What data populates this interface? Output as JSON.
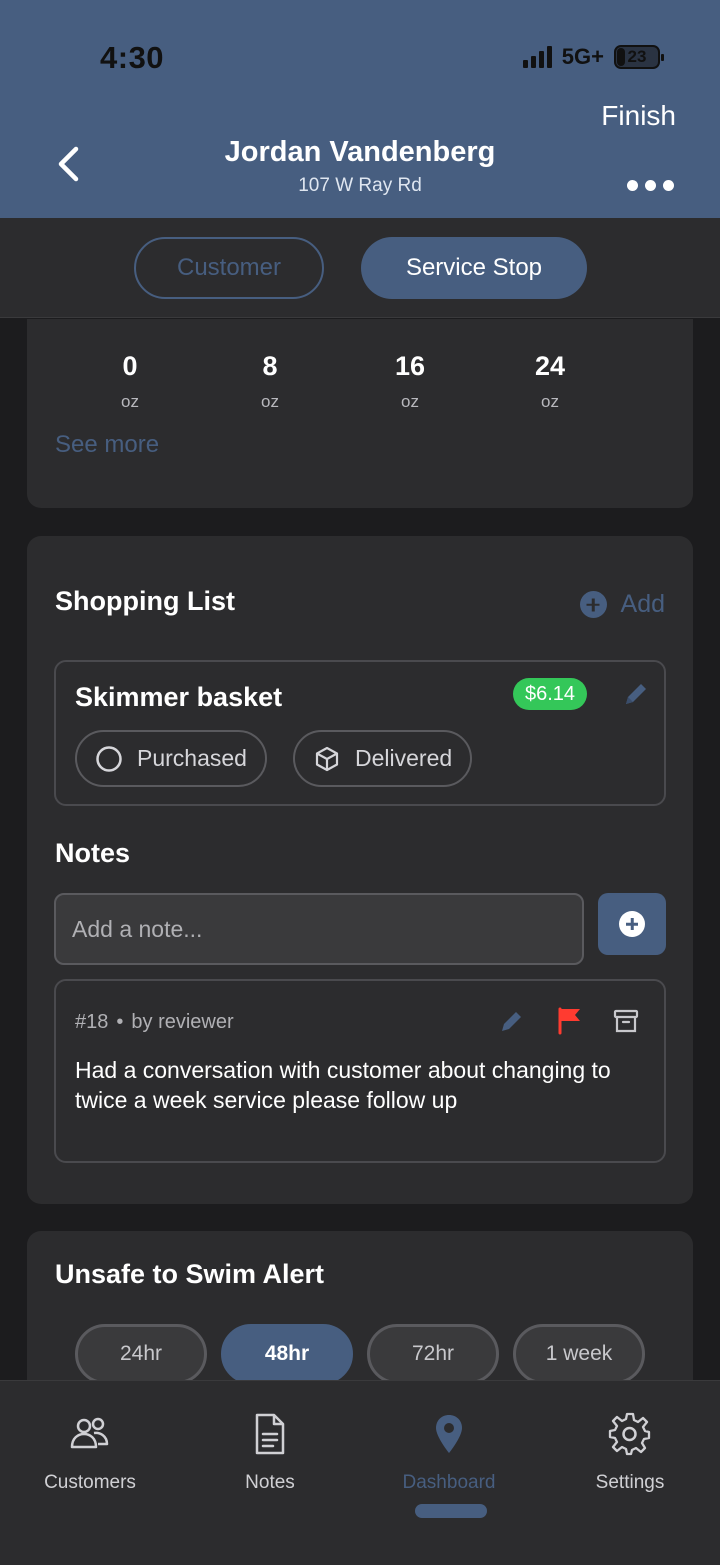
{
  "status": {
    "time": "4:30",
    "network": "5G+",
    "battery": "23"
  },
  "header": {
    "title": "Jordan Vandenberg",
    "subtitle": "107 W Ray Rd",
    "finish_label": "Finish"
  },
  "segments": {
    "customer": "Customer",
    "service_stop": "Service Stop"
  },
  "dosage": {
    "items": [
      {
        "value": "0",
        "unit": "oz"
      },
      {
        "value": "8",
        "unit": "oz"
      },
      {
        "value": "16",
        "unit": "oz"
      },
      {
        "value": "24",
        "unit": "oz"
      }
    ],
    "see_more": "See more"
  },
  "shopping": {
    "title": "Shopping List",
    "add_label": "Add",
    "item": {
      "name": "Skimmer basket",
      "price": "$6.14",
      "purchased_label": "Purchased",
      "delivered_label": "Delivered"
    }
  },
  "notes": {
    "title": "Notes",
    "placeholder": "Add a note...",
    "entry": {
      "id": "#18",
      "separator": "•",
      "author": "by reviewer",
      "text": "Had a conversation with customer about changing to twice a week service please follow up"
    }
  },
  "alert": {
    "title": "Unsafe to Swim Alert",
    "options": [
      "24hr",
      "48hr",
      "72hr",
      "1 week"
    ],
    "selected": "48hr"
  },
  "tabs": {
    "customers": "Customers",
    "notes": "Notes",
    "dashboard": "Dashboard",
    "settings": "Settings"
  },
  "colors": {
    "accent": "#475e80",
    "background": "#1c1c1e",
    "card": "#2c2c2e",
    "price_badge": "#34c759",
    "flag": "#ff3b30"
  }
}
